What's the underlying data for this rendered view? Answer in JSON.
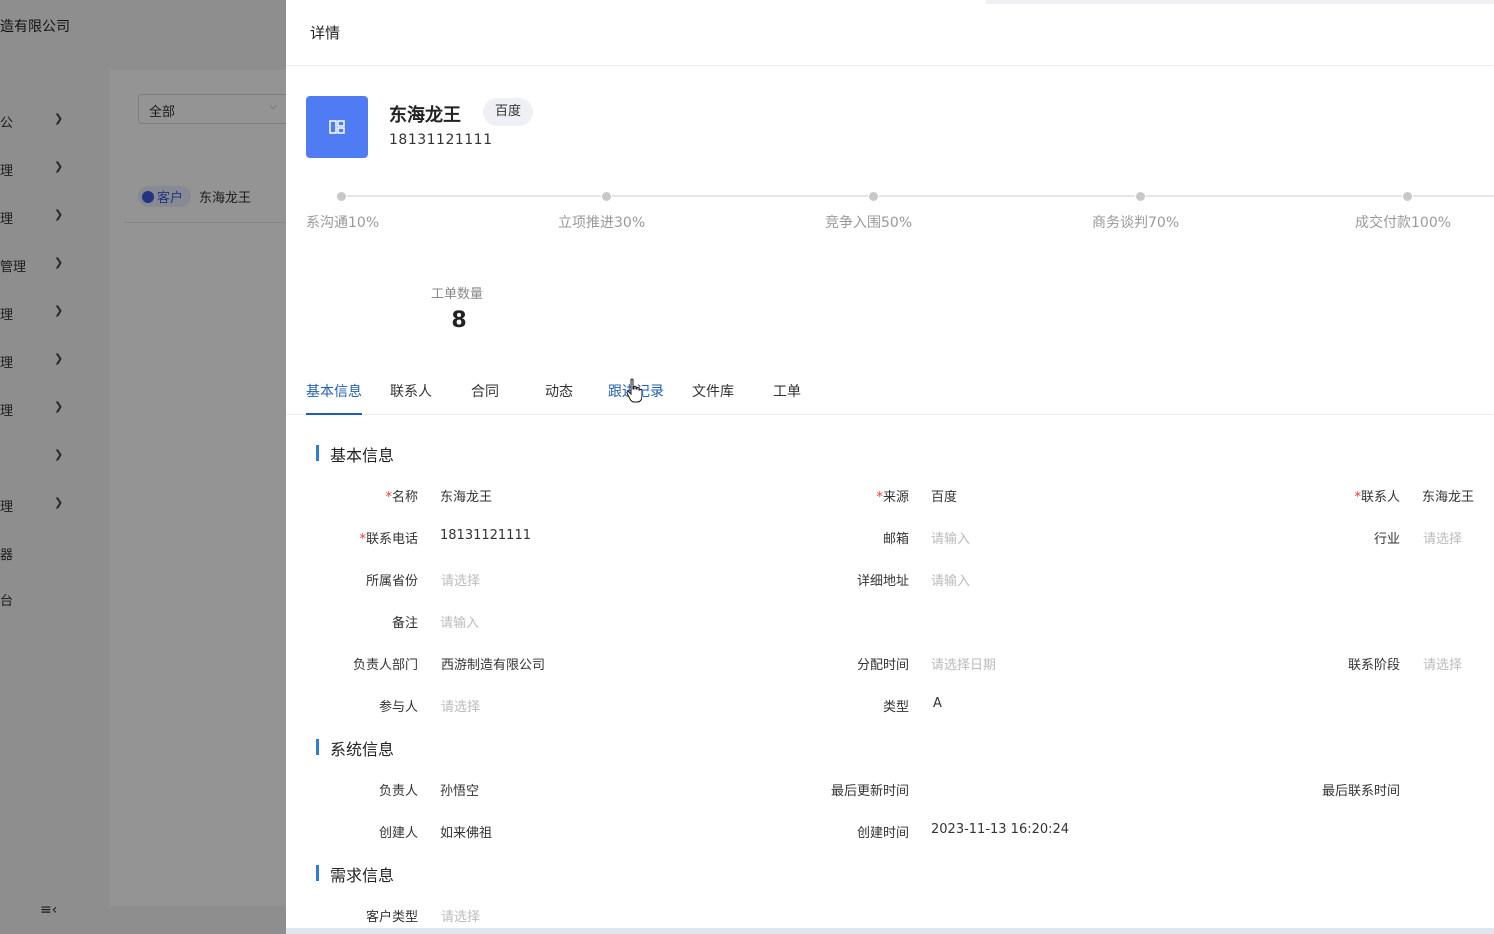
{
  "background": {
    "company": "造有限公司",
    "sidebar": [
      {
        "label": "公",
        "chevron": "chevron-down-icon"
      },
      {
        "label": "理",
        "chevron": "chevron-down-icon"
      },
      {
        "label": "理",
        "chevron": "chevron-down-icon"
      },
      {
        "label": "管理",
        "chevron": "chevron-down-icon"
      },
      {
        "label": "理",
        "chevron": "chevron-down-icon"
      },
      {
        "label": "理",
        "chevron": "chevron-down-icon"
      },
      {
        "label": "理",
        "chevron": "chevron-down-icon"
      },
      {
        "label": "",
        "chevron": "chevron-down-icon"
      },
      {
        "label": "理",
        "chevron": "chevron-down-icon"
      },
      {
        "label": "器",
        "chevron": ""
      },
      {
        "label": "台",
        "chevron": ""
      }
    ],
    "filter_select": "全部",
    "crumb_tag": "客户",
    "crumb_name": "东海龙王",
    "collapse_icon": "menu-collapse-icon"
  },
  "drawer": {
    "title": "详情",
    "customer": {
      "name": "东海龙王",
      "source_badge": "百度",
      "phone": "18131121111",
      "avatar_icon": "layout-icon",
      "avatar_color": "#4f7cf3"
    },
    "stages": [
      "系沟通10%",
      "立项推进30%",
      "竞争入围50%",
      "商务谈判70%",
      "成交付款100%"
    ],
    "stat": {
      "label": "工单数量",
      "value": "8"
    },
    "tabs": [
      "基本信息",
      "联系人",
      "合同",
      "动态",
      "跟进记录",
      "文件库",
      "工单"
    ],
    "active_tab": "基本信息",
    "sections": {
      "basic": {
        "title": "基本信息",
        "fields": {
          "name": {
            "label": "名称",
            "value": "东海龙王"
          },
          "source": {
            "label": "来源",
            "value": "百度"
          },
          "contact": {
            "label": "联系人",
            "value": "东海龙王"
          },
          "phone": {
            "label": "联系电话",
            "value": "18131121111"
          },
          "email": {
            "label": "邮箱",
            "value": "请输入"
          },
          "industry": {
            "label": "行业",
            "value": "请选择"
          },
          "province": {
            "label": "所属省份",
            "value": "请选择"
          },
          "address": {
            "label": "详细地址",
            "value": "请输入"
          },
          "remark": {
            "label": "备注",
            "value": "请输入"
          },
          "dept": {
            "label": "负责人部门",
            "value": "西游制造有限公司"
          },
          "assign_time": {
            "label": "分配时间",
            "value": "请选择日期"
          },
          "stage": {
            "label": "联系阶段",
            "value": "请选择"
          },
          "participants": {
            "label": "参与人",
            "value": "请选择"
          },
          "type": {
            "label": "类型",
            "value": "A"
          }
        }
      },
      "system": {
        "title": "系统信息",
        "fields": {
          "owner": {
            "label": "负责人",
            "value": "孙悟空"
          },
          "last_update": {
            "label": "最后更新时间",
            "value": ""
          },
          "last_contact": {
            "label": "最后联系时间",
            "value": ""
          },
          "creator": {
            "label": "创建人",
            "value": "如来佛祖"
          },
          "created_at": {
            "label": "创建时间",
            "value": "2023-11-13 16:20:24"
          }
        }
      },
      "demand": {
        "title": "需求信息",
        "fields": {
          "customer_type": {
            "label": "客户类型",
            "value": "请选择"
          }
        }
      }
    }
  },
  "colors": {
    "accent": "#1f5fb4",
    "section_bar": "#2f7bd8",
    "required": "#e33"
  }
}
